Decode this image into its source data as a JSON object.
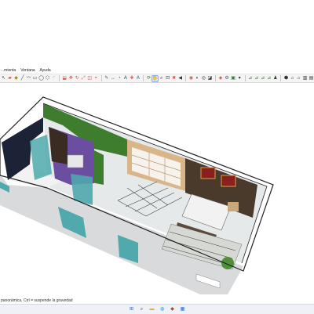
{
  "menu": {
    "items": [
      {
        "label": "...mienta"
      },
      {
        "label": "Ventana"
      },
      {
        "label": "Ayuda"
      }
    ]
  },
  "toolbar": {
    "groups": [
      [
        {
          "icon": "select-arrow-icon",
          "glyph": "↖",
          "color": "#333333"
        },
        {
          "icon": "eraser-icon",
          "glyph": "▰",
          "color": "#d9534f"
        },
        {
          "icon": "paint-bucket-icon",
          "glyph": "◆",
          "color": "#b8860b"
        },
        {
          "icon": "line-tool-icon",
          "glyph": "╱",
          "color": "#444444"
        },
        {
          "icon": "freehand-icon",
          "glyph": "〰",
          "color": "#444444"
        },
        {
          "icon": "rectangle-icon",
          "glyph": "▭",
          "color": "#444444"
        },
        {
          "icon": "circle-icon",
          "glyph": "◯",
          "color": "#444444"
        },
        {
          "icon": "polygon-icon",
          "glyph": "⬡",
          "color": "#444444"
        },
        {
          "icon": "arc-icon",
          "glyph": "◜",
          "color": "#d9534f"
        }
      ],
      [
        {
          "icon": "push-pull-icon",
          "glyph": "⬓",
          "color": "#d9534f"
        },
        {
          "icon": "move-icon",
          "glyph": "✥",
          "color": "#d9534f"
        },
        {
          "icon": "rotate-icon",
          "glyph": "↻",
          "color": "#d9534f"
        },
        {
          "icon": "scale-icon",
          "glyph": "⤢",
          "color": "#d9534f"
        },
        {
          "icon": "offset-icon",
          "glyph": "◫",
          "color": "#d9534f"
        },
        {
          "icon": "follow-me-icon",
          "glyph": "◓",
          "color": "#d9534f"
        }
      ],
      [
        {
          "icon": "tape-measure-icon",
          "glyph": "✎",
          "color": "#555555"
        },
        {
          "icon": "dimension-icon",
          "glyph": "↔",
          "color": "#555555"
        },
        {
          "icon": "protractor-icon",
          "glyph": "◔",
          "color": "#555555"
        },
        {
          "icon": "text-tool-icon",
          "glyph": "A",
          "color": "#333333"
        },
        {
          "icon": "axes-icon",
          "glyph": "✚",
          "color": "#d9534f"
        },
        {
          "icon": "3d-text-icon",
          "glyph": "A",
          "color": "#1f4f9a"
        }
      ],
      [
        {
          "icon": "orbit-icon",
          "glyph": "⟳",
          "color": "#2a7a2a"
        },
        {
          "icon": "pan-icon",
          "glyph": "✋",
          "color": "#b0802a",
          "active": true
        },
        {
          "icon": "zoom-icon",
          "glyph": "⌕",
          "color": "#333333"
        },
        {
          "icon": "zoom-window-icon",
          "glyph": "⊡",
          "color": "#333333"
        },
        {
          "icon": "zoom-extents-icon",
          "glyph": "✖",
          "color": "#d9534f"
        },
        {
          "icon": "previous-view-icon",
          "glyph": "◀",
          "color": "#333333"
        }
      ],
      [
        {
          "icon": "position-camera-icon",
          "glyph": "◉",
          "color": "#d9534f"
        },
        {
          "icon": "walk-icon",
          "glyph": "◐",
          "color": "#333333"
        },
        {
          "icon": "look-around-icon",
          "glyph": "◎",
          "color": "#333333"
        },
        {
          "icon": "section-plane-icon",
          "glyph": "◪",
          "color": "#333333"
        }
      ],
      [
        {
          "icon": "warehouse-icon",
          "glyph": "◈",
          "color": "#c0392b"
        },
        {
          "icon": "extension-warehouse-icon",
          "glyph": "⚙",
          "color": "#555555"
        },
        {
          "icon": "layout-icon",
          "glyph": "▣",
          "color": "#2a7a2a"
        },
        {
          "icon": "dropdown-icon",
          "glyph": "▾",
          "color": "#333333"
        }
      ],
      [
        {
          "icon": "dimension-a-icon",
          "glyph": "⊿",
          "color": "#2a7a2a"
        },
        {
          "icon": "dimension-b-icon",
          "glyph": "⊿",
          "color": "#2a7a2a"
        },
        {
          "icon": "dimension-c-icon",
          "glyph": "⊿",
          "color": "#2a7a2a"
        },
        {
          "icon": "dimension-d-icon",
          "glyph": "⊿",
          "color": "#2a7a2a"
        },
        {
          "icon": "scale-figure-icon",
          "glyph": "♟",
          "color": "#333333"
        }
      ],
      [
        {
          "icon": "iso-view-icon",
          "glyph": "⬢",
          "color": "#333333"
        },
        {
          "icon": "top-view-icon",
          "glyph": "⌂",
          "color": "#333333"
        },
        {
          "icon": "front-view-icon",
          "glyph": "⌂",
          "color": "#333333"
        },
        {
          "icon": "right-view-icon",
          "glyph": "▥",
          "color": "#333333"
        },
        {
          "icon": "back-view-icon",
          "glyph": "▤",
          "color": "#333333"
        }
      ]
    ]
  },
  "status": {
    "text": "panorámica, Ctrl = suspende la gravedad"
  },
  "colors": {
    "floor": "#e6e9ea",
    "wall_top": "#ffffff",
    "wall_outline": "#222222",
    "exterior_wall": "#d9dadb",
    "green_wall": "#3f7d2e",
    "navy_wall": "#1c2336",
    "teal_glass": "#4fa9ad",
    "purple_wall": "#6b4ea0",
    "stone_wall": "#4a3a2c",
    "wood_panel": "#d9b68a"
  },
  "taskbar": {
    "icons": [
      {
        "icon": "windows-start-icon",
        "glyph": "⊞",
        "color": "#1e6fd9"
      },
      {
        "icon": "taskbar-search-icon",
        "glyph": "⌕",
        "color": "#444444"
      },
      {
        "icon": "file-explorer-icon",
        "glyph": "▬",
        "color": "#e3a92b"
      },
      {
        "icon": "browser-icon",
        "glyph": "◍",
        "color": "#1f8fd6"
      },
      {
        "icon": "sketchup-app-icon",
        "glyph": "◆",
        "color": "#c0392b"
      },
      {
        "icon": "store-icon",
        "glyph": "▦",
        "color": "#2a6fd6"
      }
    ]
  }
}
